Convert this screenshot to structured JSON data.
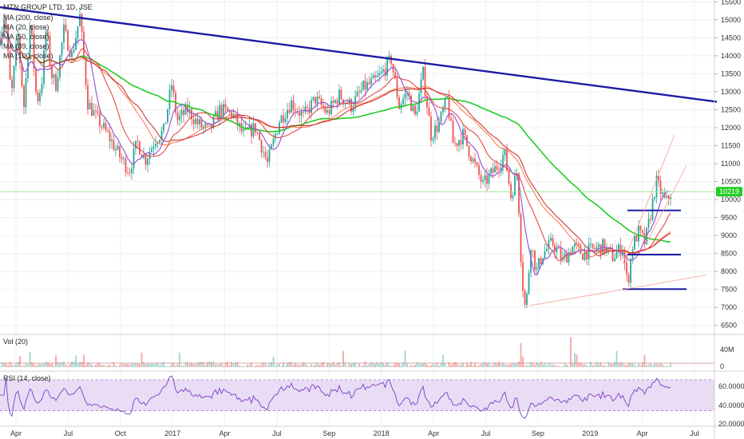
{
  "symbol_title": "MTN GROUP LTD, 1D, JSE",
  "legend": {
    "ma200": "MA (200, close)",
    "ma20": "MA (20, close)",
    "ma50": "MA (50, close)",
    "ma89": "MA (89, close)",
    "ma100": "MA (100, close)"
  },
  "volume_label": "Vol (20)",
  "rsi_label": "RSI (14, close)",
  "last_price": "10219",
  "colors": {
    "up": "#26a69a",
    "down": "#ef5350",
    "ma200": "#22cc22",
    "ma20": "#9b59d0",
    "ma50": "#e53935",
    "ma89": "#ff7043",
    "ma100": "#c62828",
    "trendline": "#1a1aa6",
    "rsi_line": "#7b3fc4",
    "rsi_band": "#e9dcf5",
    "last_price_bg": "#22cc22"
  },
  "chart_data": {
    "type": "candlestick",
    "title": "MTN GROUP LTD, 1D, JSE",
    "price_axis": {
      "range": [
        6250,
        15550
      ],
      "ticks": [
        "15500",
        "15000",
        "14500",
        "14000",
        "13500",
        "13000",
        "12500",
        "12000",
        "11500",
        "11000",
        "10500",
        "10000",
        "9500",
        "9000",
        "8500",
        "8000",
        "7500",
        "7000",
        "6500"
      ]
    },
    "time_axis_labels": [
      "Apr",
      "Jul",
      "Oct",
      "2017",
      "Apr",
      "Jul",
      "Sep",
      "2018",
      "Apr",
      "Jul",
      "Sep",
      "2019",
      "Apr",
      "Jul"
    ],
    "price_path_anchors": [
      {
        "t": 0,
        "p": 14500
      },
      {
        "t": 6,
        "p": 15200
      },
      {
        "t": 14,
        "p": 12800
      },
      {
        "t": 22,
        "p": 14600
      },
      {
        "t": 30,
        "p": 12600
      },
      {
        "t": 38,
        "p": 15000
      },
      {
        "t": 46,
        "p": 12700
      },
      {
        "t": 52,
        "p": 13200
      },
      {
        "t": 58,
        "p": 14800
      },
      {
        "t": 64,
        "p": 13500
      },
      {
        "t": 70,
        "p": 13200
      },
      {
        "t": 80,
        "p": 14700
      },
      {
        "t": 90,
        "p": 14000
      },
      {
        "t": 100,
        "p": 15100
      },
      {
        "t": 110,
        "p": 12700
      },
      {
        "t": 120,
        "p": 12300
      },
      {
        "t": 135,
        "p": 11800
      },
      {
        "t": 150,
        "p": 11200
      },
      {
        "t": 162,
        "p": 10800
      },
      {
        "t": 172,
        "p": 11600
      },
      {
        "t": 182,
        "p": 11100
      },
      {
        "t": 195,
        "p": 11700
      },
      {
        "t": 205,
        "p": 11900
      },
      {
        "t": 215,
        "p": 13200
      },
      {
        "t": 222,
        "p": 12200
      },
      {
        "t": 235,
        "p": 12500
      },
      {
        "t": 248,
        "p": 12100
      },
      {
        "t": 262,
        "p": 11900
      },
      {
        "t": 275,
        "p": 12500
      },
      {
        "t": 290,
        "p": 12400
      },
      {
        "t": 305,
        "p": 11800
      },
      {
        "t": 320,
        "p": 12000
      },
      {
        "t": 335,
        "p": 11000
      },
      {
        "t": 350,
        "p": 12200
      },
      {
        "t": 365,
        "p": 12700
      },
      {
        "t": 380,
        "p": 12300
      },
      {
        "t": 395,
        "p": 12800
      },
      {
        "t": 410,
        "p": 12400
      },
      {
        "t": 425,
        "p": 12900
      },
      {
        "t": 440,
        "p": 12600
      },
      {
        "t": 455,
        "p": 13100
      },
      {
        "t": 470,
        "p": 13300
      },
      {
        "t": 478,
        "p": 13500
      },
      {
        "t": 490,
        "p": 13900
      },
      {
        "t": 500,
        "p": 12600
      },
      {
        "t": 510,
        "p": 13000
      },
      {
        "t": 520,
        "p": 12300
      },
      {
        "t": 530,
        "p": 13500
      },
      {
        "t": 540,
        "p": 11800
      },
      {
        "t": 550,
        "p": 12100
      },
      {
        "t": 560,
        "p": 12800
      },
      {
        "t": 568,
        "p": 11500
      },
      {
        "t": 580,
        "p": 11800
      },
      {
        "t": 592,
        "p": 11100
      },
      {
        "t": 605,
        "p": 10400
      },
      {
        "t": 615,
        "p": 10700
      },
      {
        "t": 625,
        "p": 11000
      },
      {
        "t": 632,
        "p": 11300
      },
      {
        "t": 640,
        "p": 10100
      },
      {
        "t": 648,
        "p": 10800
      },
      {
        "t": 653,
        "p": 8200
      },
      {
        "t": 657,
        "p": 7000
      },
      {
        "t": 660,
        "p": 7300
      },
      {
        "t": 665,
        "p": 8800
      },
      {
        "t": 672,
        "p": 8000
      },
      {
        "t": 680,
        "p": 8500
      },
      {
        "t": 692,
        "p": 8800
      },
      {
        "t": 705,
        "p": 8300
      },
      {
        "t": 718,
        "p": 8700
      },
      {
        "t": 730,
        "p": 8500
      },
      {
        "t": 742,
        "p": 8600
      },
      {
        "t": 755,
        "p": 8700
      },
      {
        "t": 768,
        "p": 8400
      },
      {
        "t": 780,
        "p": 8700
      },
      {
        "t": 786,
        "p": 7600
      },
      {
        "t": 792,
        "p": 8700
      },
      {
        "t": 800,
        "p": 9100
      },
      {
        "t": 808,
        "p": 8800
      },
      {
        "t": 815,
        "p": 9600
      },
      {
        "t": 822,
        "p": 10500
      },
      {
        "t": 828,
        "p": 10200
      },
      {
        "t": 834,
        "p": 9900
      },
      {
        "t": 840,
        "p": 10200
      }
    ],
    "annotations": {
      "long_trendline": {
        "from": [
          0,
          15350
        ],
        "to": [
          898,
          12720
        ]
      },
      "resistance_1": {
        "from": [
          786,
          9700
        ],
        "to": [
          853,
          9700
        ]
      },
      "support_1": {
        "from": [
          786,
          8470
        ],
        "to": [
          853,
          8470
        ]
      },
      "support_2": {
        "from": [
          780,
          7510
        ],
        "to": [
          860,
          7510
        ]
      },
      "channel_lower": {
        "from": [
          663,
          7050
        ],
        "to": [
          885,
          7900
        ]
      },
      "channel_upper_1": {
        "from": [
          780,
          8200
        ],
        "to": [
          845,
          11800
        ]
      },
      "channel_upper_2": {
        "from": [
          810,
          8800
        ],
        "to": [
          860,
          10950
        ]
      },
      "last_price_line": 10219
    },
    "volume_axis": {
      "ticks": [
        "40M",
        "0"
      ]
    },
    "rsi_axis": {
      "ticks": [
        "60.0000",
        "40.0000",
        "20.0000"
      ],
      "band": [
        30,
        70
      ]
    }
  }
}
